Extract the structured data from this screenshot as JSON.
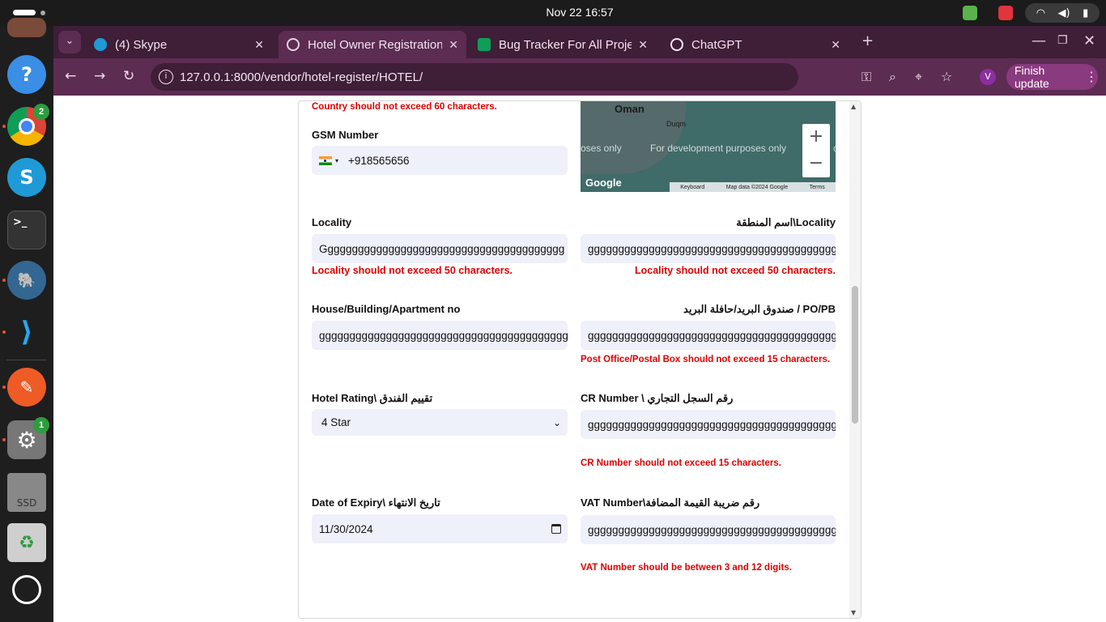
{
  "system": {
    "clock": "Nov 22  16:57"
  },
  "dock": {
    "chrome_badge": "2",
    "settings_badge": "1",
    "ssd_label": "SSD"
  },
  "browser": {
    "tabs": [
      {
        "title": "(4) Skype"
      },
      {
        "title": "Hotel Owner Registration"
      },
      {
        "title": "Bug Tracker For All Proje"
      },
      {
        "title": "ChatGPT"
      }
    ],
    "url": "127.0.0.1:8000/vendor/hotel-register/HOTEL/",
    "profile_initial": "V",
    "update_label": "Finish update"
  },
  "map": {
    "place": "Oman",
    "duqm": "Duqm",
    "watermark_left": "oses only",
    "watermark": "For development purposes only",
    "watermark_right": "c",
    "logo": "Google",
    "keyboard": "Keyboard",
    "map_data": "Map data ©2024 Google",
    "terms": "Terms",
    "zoom_in": "+",
    "zoom_out": "−"
  },
  "form": {
    "country_error": "Country should not exceed 60 characters.",
    "gsm": {
      "label": "GSM Number",
      "value": "+918565656"
    },
    "locality": {
      "label": "Locality",
      "value": "Gggggggggggggggggggggggggggggggggggggggg",
      "error": "Locality should not exceed 50 characters."
    },
    "locality_ar": {
      "label": "اسم المنطقة\\Locality",
      "value": "gggggggggggggggggggggggggggggggggggggggggg",
      "error": "Locality should not exceed 50 characters."
    },
    "house": {
      "label": "House/Building/Apartment no",
      "value": "gggggggggggggggggggggggggggggggggggggggggg"
    },
    "po": {
      "label": "صندوق البريد/حافلة البريد / PO/PB",
      "value": "gggggggggggggggggggggggggggggggggggggggggg",
      "error": "Post Office/Postal Box should not exceed 15 characters."
    },
    "rating": {
      "label": "Hotel Rating\\ تقييم الفندق",
      "value": "4 Star"
    },
    "cr": {
      "label": "CR Number \\ رقم السجل التجاري",
      "value": "gggggggggggggggggggggggggggggggggggggggggg",
      "error": "CR Number should not exceed 15 characters."
    },
    "expiry": {
      "label": "Date of Expiry\\ تاريخ الانتهاء",
      "value": "11/30/2024"
    },
    "vat": {
      "label": "VAT Number\\رقم ضريبة القيمة المضافة",
      "value": "gggggggggggggggggggggggggggggggggggggggggg",
      "error": "VAT Number should be between 3 and 12 digits."
    }
  }
}
